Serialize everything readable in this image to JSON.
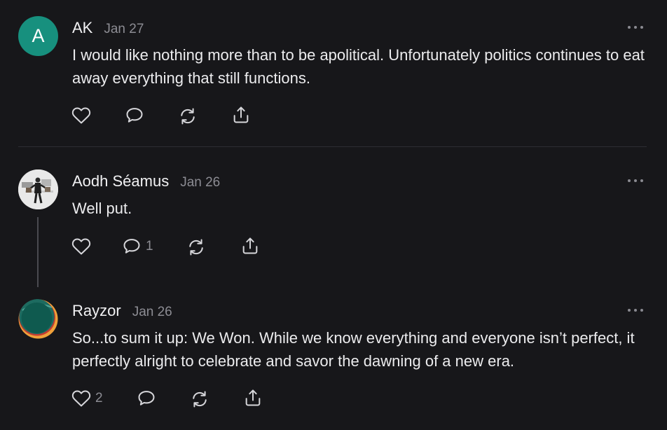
{
  "theme": {
    "background": "#17171a",
    "text": "#ececee",
    "muted": "#8c8c93",
    "avatar_ak": "#17907e"
  },
  "comments": [
    {
      "author": "AK",
      "avatar_letter": "A",
      "date": "Jan 27",
      "text": "I would like nothing more than to be apolitical. Unfortunately politics continues to eat away everything that still functions.",
      "like_count": "",
      "reply_count": ""
    },
    {
      "author": "Aodh Séamus",
      "date": "Jan 26",
      "text": "Well put.",
      "like_count": "",
      "reply_count": "1"
    },
    {
      "author": "Rayzor",
      "date": "Jan 26",
      "text": "So...to sum it up: We Won. While we know everything and everyone isn’t perfect, it perfectly alright to celebrate and savor the dawning of a new era.",
      "like_count": "2",
      "reply_count": ""
    }
  ],
  "icons": [
    "heart-icon",
    "comment-icon",
    "restack-icon",
    "share-icon",
    "more-options-icon"
  ]
}
